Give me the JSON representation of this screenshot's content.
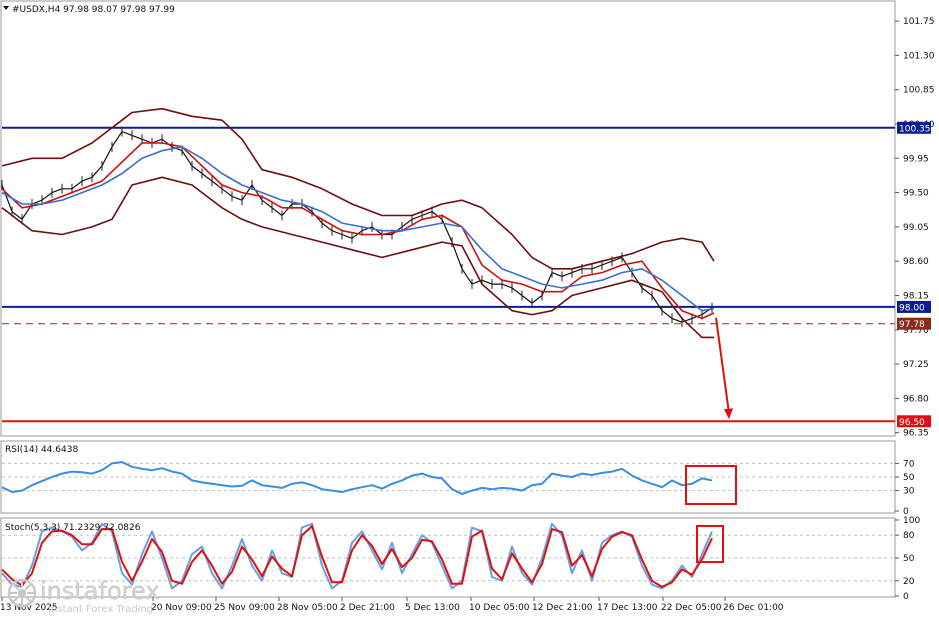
{
  "chart_data": [
    {
      "type": "line",
      "panel": "price",
      "title": "#USDX,H4  97.98 98.07 97.98 97.99",
      "axis": {
        "ticks": [
          101.75,
          101.3,
          100.85,
          100.4,
          99.95,
          99.5,
          99.05,
          98.6,
          98.15,
          97.7,
          97.25,
          96.8,
          96.35
        ],
        "ylim": [
          96.32,
          102.0
        ]
      },
      "levels": [
        {
          "value": 100.35,
          "label": "100.35",
          "color": "#0a1f8f"
        },
        {
          "value": 98.0,
          "label": "98.00",
          "color": "#0a1f8f"
        },
        {
          "value": 97.78,
          "label": "97.78",
          "color": "#8b2a1a"
        },
        {
          "value": 96.5,
          "label": "96.50",
          "color": "#dd1111"
        }
      ],
      "series": [
        {
          "role": "close",
          "color": "#111111",
          "x": [
            0,
            10,
            20,
            30,
            40,
            50,
            60,
            70,
            80,
            90,
            100,
            110,
            120,
            130,
            140,
            150,
            160,
            170,
            180,
            190,
            200,
            210,
            220,
            230,
            240,
            250,
            260,
            270,
            280,
            290,
            300,
            310,
            320,
            330,
            340,
            350,
            360,
            370,
            380,
            390,
            400,
            410,
            420,
            430,
            440,
            450,
            460,
            470,
            480,
            490,
            500,
            510,
            520,
            530,
            540,
            550,
            560,
            570,
            580,
            590,
            600,
            610,
            620,
            630,
            640,
            650,
            660,
            670,
            680,
            690,
            700,
            710
          ],
          "y": [
            99.6,
            99.25,
            99.15,
            99.35,
            99.4,
            99.5,
            99.55,
            99.55,
            99.65,
            99.7,
            99.85,
            100.1,
            100.3,
            100.25,
            100.2,
            100.15,
            100.2,
            100.1,
            100.05,
            99.85,
            99.75,
            99.65,
            99.55,
            99.45,
            99.4,
            99.6,
            99.4,
            99.3,
            99.2,
            99.35,
            99.35,
            99.25,
            99.1,
            99.0,
            98.95,
            98.9,
            99.0,
            99.05,
            98.95,
            98.95,
            99.05,
            99.15,
            99.2,
            99.25,
            99.15,
            98.85,
            98.5,
            98.3,
            98.35,
            98.3,
            98.3,
            98.25,
            98.15,
            98.05,
            98.15,
            98.45,
            98.4,
            98.45,
            98.5,
            98.5,
            98.55,
            98.6,
            98.65,
            98.45,
            98.25,
            98.15,
            97.95,
            97.85,
            97.8,
            97.85,
            97.9,
            97.99
          ]
        },
        {
          "role": "bollinger-upper",
          "color": "#6b0f0f",
          "x": [
            0,
            30,
            60,
            90,
            110,
            130,
            160,
            190,
            220,
            240,
            260,
            290,
            320,
            350,
            380,
            410,
            440,
            460,
            480,
            510,
            530,
            550,
            570,
            600,
            630,
            660,
            680,
            700,
            712
          ],
          "y": [
            99.85,
            99.95,
            99.95,
            100.15,
            100.35,
            100.55,
            100.6,
            100.5,
            100.45,
            100.2,
            99.8,
            99.7,
            99.55,
            99.35,
            99.2,
            99.2,
            99.35,
            99.4,
            99.3,
            98.95,
            98.65,
            98.5,
            98.5,
            98.6,
            98.7,
            98.85,
            98.9,
            98.85,
            98.6
          ]
        },
        {
          "role": "bollinger-lower",
          "color": "#6b0f0f",
          "x": [
            0,
            30,
            60,
            90,
            110,
            130,
            160,
            190,
            220,
            240,
            260,
            290,
            320,
            350,
            380,
            410,
            440,
            460,
            480,
            510,
            530,
            550,
            570,
            600,
            630,
            660,
            680,
            700,
            712
          ],
          "y": [
            99.3,
            99.0,
            98.95,
            99.05,
            99.15,
            99.6,
            99.7,
            99.6,
            99.3,
            99.15,
            99.05,
            98.95,
            98.85,
            98.75,
            98.65,
            98.75,
            98.85,
            98.8,
            98.3,
            97.95,
            97.9,
            97.95,
            98.15,
            98.25,
            98.35,
            98.2,
            97.85,
            97.6,
            97.6
          ]
        },
        {
          "role": "ma-fast",
          "color": "#cc1111",
          "x": [
            0,
            20,
            40,
            60,
            80,
            100,
            120,
            140,
            160,
            180,
            200,
            220,
            240,
            260,
            280,
            300,
            320,
            340,
            360,
            380,
            400,
            420,
            440,
            460,
            480,
            500,
            520,
            540,
            560,
            580,
            600,
            620,
            640,
            660,
            680,
            700,
            712
          ],
          "y": [
            99.55,
            99.3,
            99.35,
            99.45,
            99.55,
            99.65,
            99.9,
            100.15,
            100.15,
            100.1,
            99.85,
            99.6,
            99.5,
            99.45,
            99.3,
            99.3,
            99.15,
            99.0,
            98.95,
            98.95,
            99.0,
            99.15,
            99.2,
            99.05,
            98.55,
            98.35,
            98.3,
            98.2,
            98.2,
            98.4,
            98.45,
            98.55,
            98.6,
            98.25,
            97.95,
            97.85,
            97.92
          ]
        },
        {
          "role": "ma-slow",
          "color": "#3a6fd0",
          "x": [
            0,
            20,
            40,
            60,
            80,
            100,
            120,
            140,
            160,
            180,
            200,
            220,
            240,
            260,
            280,
            300,
            320,
            340,
            360,
            380,
            400,
            420,
            440,
            460,
            480,
            500,
            520,
            540,
            560,
            580,
            600,
            620,
            640,
            660,
            680,
            700,
            712
          ],
          "y": [
            99.5,
            99.35,
            99.35,
            99.4,
            99.5,
            99.6,
            99.75,
            99.95,
            100.05,
            100.1,
            99.95,
            99.75,
            99.6,
            99.5,
            99.4,
            99.35,
            99.25,
            99.1,
            99.05,
            99.0,
            99.0,
            99.05,
            99.1,
            99.05,
            98.75,
            98.5,
            98.4,
            98.3,
            98.25,
            98.3,
            98.35,
            98.45,
            98.5,
            98.35,
            98.15,
            97.95,
            97.98
          ]
        }
      ]
    },
    {
      "type": "line",
      "panel": "rsi",
      "title": "RSI(14) 44.6438",
      "axis": {
        "ticks": [
          70,
          50,
          30,
          0
        ],
        "ylim": [
          0,
          100
        ]
      },
      "levels": [
        70,
        50,
        30
      ],
      "series": [
        {
          "role": "rsi",
          "color": "#3a8ee0",
          "x": [
            0,
            10,
            20,
            30,
            40,
            50,
            60,
            70,
            80,
            90,
            100,
            110,
            120,
            130,
            140,
            150,
            160,
            170,
            180,
            190,
            200,
            210,
            220,
            230,
            240,
            250,
            260,
            270,
            280,
            290,
            300,
            310,
            320,
            330,
            340,
            350,
            360,
            370,
            380,
            390,
            400,
            410,
            420,
            430,
            440,
            450,
            460,
            470,
            480,
            490,
            500,
            510,
            520,
            530,
            540,
            550,
            560,
            570,
            580,
            590,
            600,
            610,
            620,
            630,
            640,
            650,
            660,
            670,
            680,
            690,
            700,
            710
          ],
          "y": [
            35,
            28,
            30,
            38,
            44,
            50,
            55,
            58,
            57,
            55,
            60,
            70,
            72,
            65,
            62,
            60,
            63,
            58,
            55,
            45,
            42,
            40,
            38,
            36,
            37,
            45,
            38,
            36,
            34,
            40,
            42,
            38,
            32,
            30,
            28,
            32,
            35,
            38,
            33,
            40,
            45,
            52,
            55,
            50,
            48,
            32,
            25,
            30,
            34,
            32,
            34,
            33,
            30,
            38,
            40,
            55,
            52,
            50,
            55,
            53,
            56,
            58,
            62,
            52,
            45,
            40,
            35,
            45,
            38,
            40,
            48,
            45
          ]
        }
      ]
    },
    {
      "type": "line",
      "panel": "stochastic",
      "title": "Stoch(5,3,3) 71.2329 72.0826",
      "axis": {
        "ticks": [
          100,
          80,
          50,
          20,
          0
        ],
        "ylim": [
          0,
          100
        ]
      },
      "levels": [
        80,
        50,
        20
      ],
      "series": [
        {
          "role": "main",
          "color": "#6aa0e0",
          "x": [
            0,
            10,
            20,
            30,
            40,
            50,
            60,
            70,
            80,
            90,
            100,
            110,
            120,
            130,
            140,
            150,
            160,
            170,
            180,
            190,
            200,
            210,
            220,
            230,
            240,
            250,
            260,
            270,
            280,
            290,
            300,
            310,
            320,
            330,
            340,
            350,
            360,
            370,
            380,
            390,
            400,
            410,
            420,
            430,
            440,
            450,
            460,
            470,
            480,
            490,
            500,
            510,
            520,
            530,
            540,
            550,
            560,
            570,
            580,
            590,
            600,
            610,
            620,
            630,
            640,
            650,
            660,
            670,
            680,
            690,
            700,
            710
          ],
          "y": [
            30,
            15,
            12,
            40,
            85,
            90,
            85,
            78,
            60,
            70,
            95,
            85,
            30,
            15,
            55,
            85,
            50,
            10,
            20,
            55,
            65,
            30,
            10,
            40,
            75,
            40,
            20,
            60,
            30,
            25,
            90,
            95,
            40,
            10,
            20,
            70,
            85,
            60,
            35,
            70,
            30,
            55,
            80,
            70,
            40,
            10,
            20,
            90,
            85,
            25,
            20,
            65,
            30,
            15,
            50,
            95,
            80,
            30,
            60,
            20,
            70,
            80,
            85,
            78,
            40,
            15,
            10,
            20,
            40,
            25,
            55,
            85
          ]
        },
        {
          "role": "signal",
          "color": "#dd1111",
          "x": [
            0,
            10,
            20,
            30,
            40,
            50,
            60,
            70,
            80,
            90,
            100,
            110,
            120,
            130,
            140,
            150,
            160,
            170,
            180,
            190,
            200,
            210,
            220,
            230,
            240,
            250,
            260,
            270,
            280,
            290,
            300,
            310,
            320,
            330,
            340,
            350,
            360,
            370,
            380,
            390,
            400,
            410,
            420,
            430,
            440,
            450,
            460,
            470,
            480,
            490,
            500,
            510,
            520,
            530,
            540,
            550,
            560,
            570,
            580,
            590,
            600,
            610,
            620,
            630,
            640,
            650,
            660,
            670,
            680,
            690,
            700,
            710
          ],
          "y": [
            35,
            22,
            14,
            30,
            70,
            85,
            86,
            80,
            68,
            68,
            88,
            88,
            45,
            20,
            45,
            75,
            58,
            20,
            16,
            45,
            60,
            40,
            16,
            32,
            65,
            48,
            26,
            52,
            36,
            26,
            80,
            92,
            52,
            18,
            18,
            60,
            80,
            66,
            42,
            62,
            38,
            50,
            74,
            72,
            48,
            16,
            16,
            78,
            86,
            36,
            22,
            56,
            36,
            18,
            42,
            88,
            84,
            40,
            54,
            26,
            62,
            78,
            84,
            80,
            48,
            20,
            12,
            18,
            35,
            28,
            48,
            76
          ]
        }
      ]
    },
    {
      "type": "table",
      "panel": "time-axis",
      "tick_labels": [
        "13 Nov 2025",
        "20 Nov 09:00",
        "25 Nov 09:00",
        "28 Nov 05:00",
        "2 Dec 21:00",
        "5 Dec 13:00",
        "10 Dec 05:00",
        "12 Dec 21:00",
        "17 Dec 13:00",
        "22 Dec 05:00",
        "26 Dec 01:00"
      ]
    }
  ],
  "annotations": {
    "arrow_color": "#dd1111",
    "arrow_from": 97.99,
    "arrow_to": 96.5,
    "highlight_color": "#dd1111"
  },
  "watermark": {
    "brand": "instaforex",
    "tagline": "Instant Forex Trading"
  }
}
